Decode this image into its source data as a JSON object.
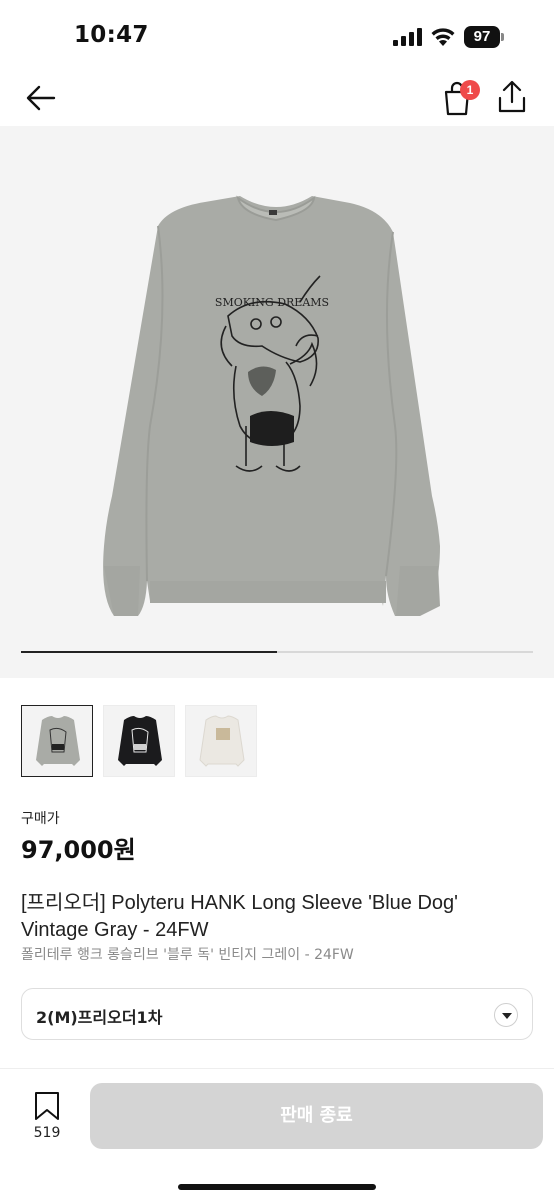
{
  "status_bar": {
    "time": "10:47",
    "battery": "97"
  },
  "header": {
    "cart_count": "1"
  },
  "gallery": {
    "progress_fraction": 0.5,
    "thumbnails": [
      {
        "color": "gray",
        "active": true
      },
      {
        "color": "black",
        "active": false
      },
      {
        "color": "white",
        "active": false
      }
    ],
    "print_text": "SMOKING DREAMS"
  },
  "price": {
    "label": "구매가",
    "value": "97,000원"
  },
  "product": {
    "title": "[프리오더] Polyteru HANK Long Sleeve 'Blue Dog' Vintage Gray - 24FW",
    "subtitle": "폴리테루 행크 롱슬리브 '블루 독' 빈티지 그레이 - 24FW"
  },
  "size_select": {
    "value": "2(M)프리오더1차"
  },
  "bottom": {
    "wish_count": "519",
    "action_label": "판매 종료"
  },
  "colors": {
    "badge": "#ef4a4a",
    "disabled_button": "#d4d4d4",
    "shirt_gray": "#a9aba6"
  }
}
